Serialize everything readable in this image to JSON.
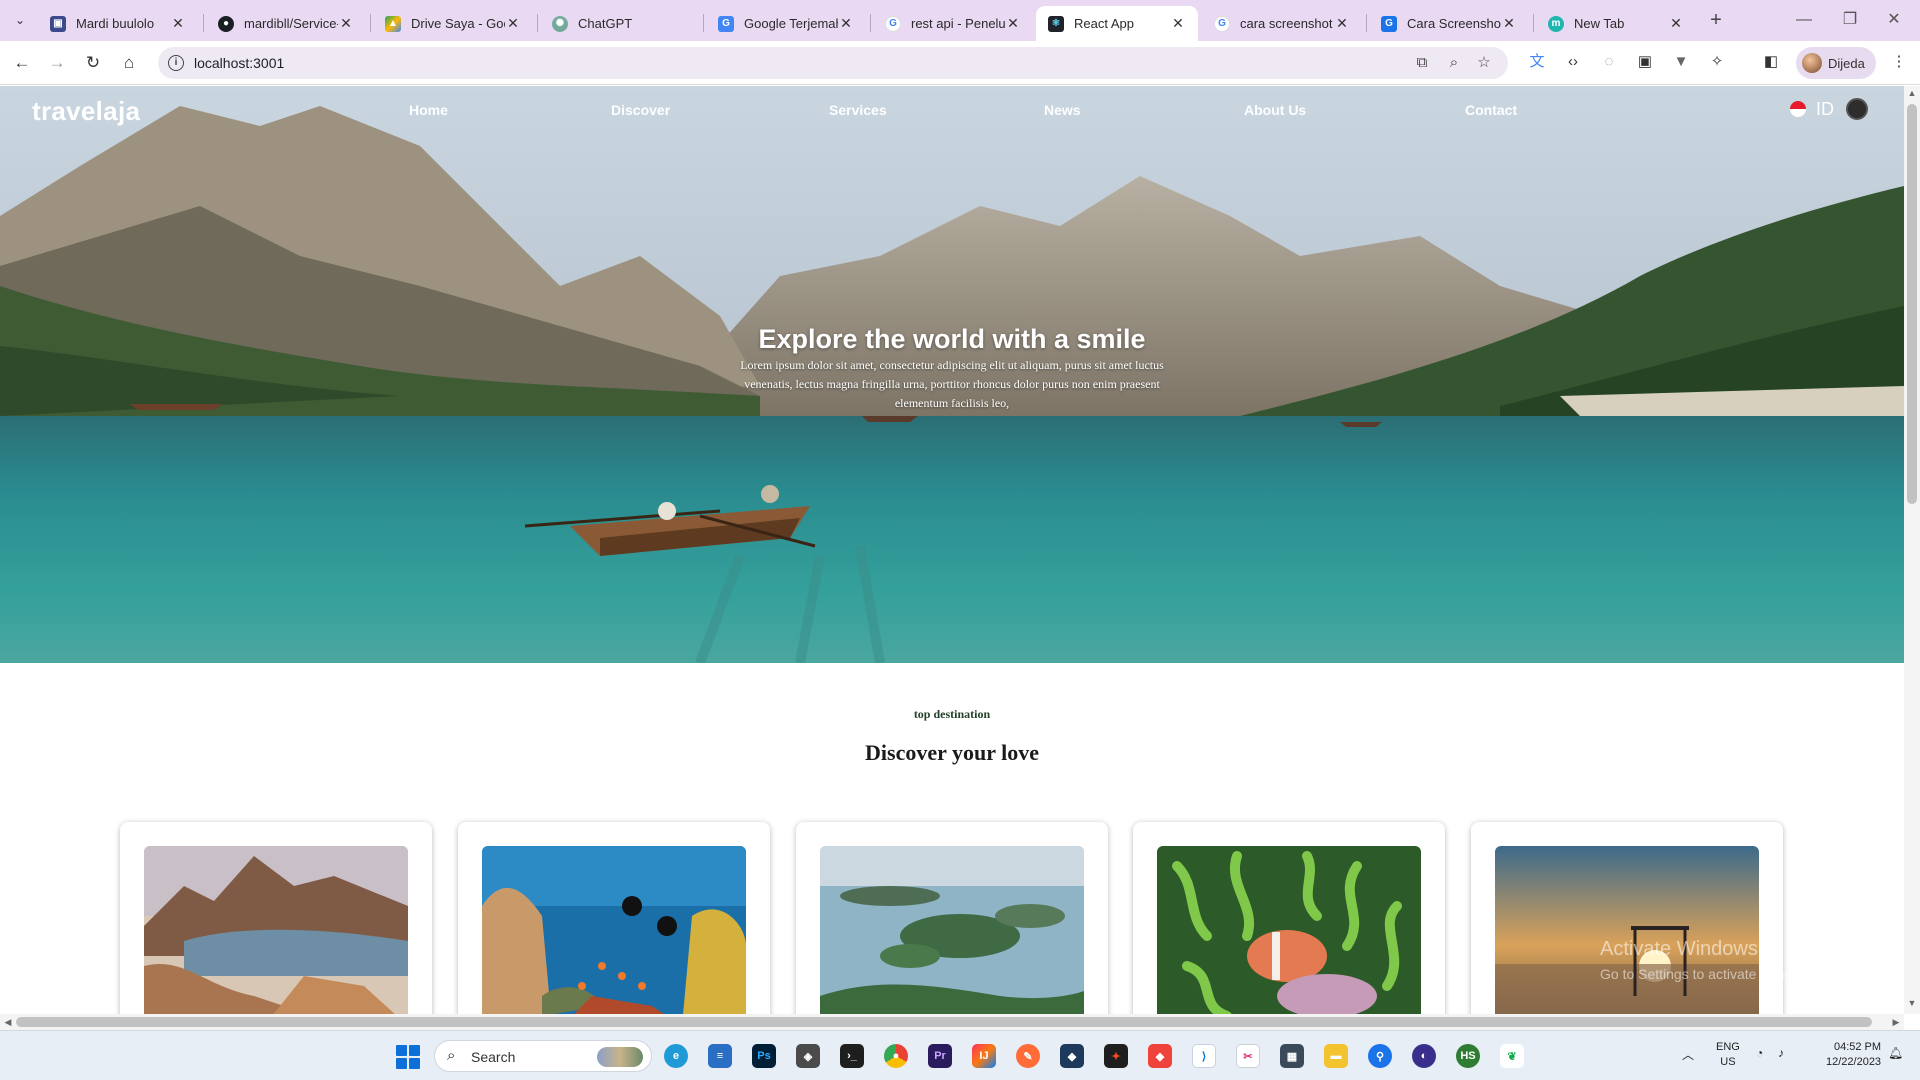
{
  "browser": {
    "tabs": [
      {
        "title": "Mardi buulolo",
        "icon": "app-icon",
        "color": "#3b4a8a",
        "active": false
      },
      {
        "title": "mardibll/Service-/",
        "icon": "github-icon",
        "color": "#1b1f23",
        "active": false
      },
      {
        "title": "Drive Saya - Goog",
        "icon": "google-drive-icon",
        "color": "#1ea362",
        "active": false
      },
      {
        "title": "ChatGPT",
        "icon": "chatgpt-icon",
        "color": "#74aa9c",
        "active": false
      },
      {
        "title": "Google Terjemaha",
        "icon": "google-translate-icon",
        "color": "#4285f4",
        "active": false
      },
      {
        "title": "rest api - Penelus",
        "icon": "google-icon",
        "color": "#4285f4",
        "active": false
      },
      {
        "title": "React App",
        "icon": "react-icon",
        "color": "#20232a",
        "active": true
      },
      {
        "title": "cara screenshot p",
        "icon": "google-icon",
        "color": "#4285f4",
        "active": false
      },
      {
        "title": "Cara Screenshot c",
        "icon": "google-icon",
        "color": "#1a73e8",
        "active": false
      },
      {
        "title": "New Tab",
        "icon": "m-icon",
        "color": "#1fb6b0",
        "active": false
      }
    ],
    "new_tab_symbol": "+",
    "url": "localhost:3001",
    "profile_name": "Dijeda"
  },
  "site": {
    "brand": "travelaja",
    "nav": [
      "Home",
      "Discover",
      "Services",
      "News",
      "About Us",
      "Contact"
    ],
    "language": "ID",
    "hero": {
      "title": "Explore the world with a smile",
      "subtitle": "Lorem ipsum dolor sit amet, consectetur adipiscing elit ut aliquam, purus sit amet luctus venenatis, lectus magna fringilla urna, porttitor rhoncus dolor purus non enim praesent elementum facilisis leo,"
    },
    "destinations": {
      "eyebrow": "top destination",
      "title": "Discover your love",
      "cards": [
        {
          "image": "komodo-padar-island-image"
        },
        {
          "image": "coral-reef-divers-image"
        },
        {
          "image": "raja-ampat-islands-image"
        },
        {
          "image": "clownfish-anemone-image"
        },
        {
          "image": "sunset-swing-sea-image"
        }
      ]
    }
  },
  "windows_watermark": {
    "line1": "Activate Windows",
    "line2": "Go to Settings to activate Windows."
  },
  "taskbar": {
    "search_placeholder": "Search",
    "apps": [
      "file-explorer-icon",
      "edge-icon",
      "notepad-icon",
      "photoshop-icon",
      "app-icon",
      "terminal-icon",
      "chrome-icon",
      "premiere-icon",
      "intellij-icon",
      "postman-icon",
      "app-icon",
      "figma-icon",
      "anydesk-icon",
      "vscode-icon",
      "snipping-tool-icon",
      "calculator-icon",
      "folder-icon",
      "maps-icon",
      "app-icon",
      "hs-icon",
      "mongodb-icon"
    ],
    "language_line1": "ENG",
    "language_line2": "US",
    "time": "04:52 PM",
    "date": "12/22/2023"
  }
}
